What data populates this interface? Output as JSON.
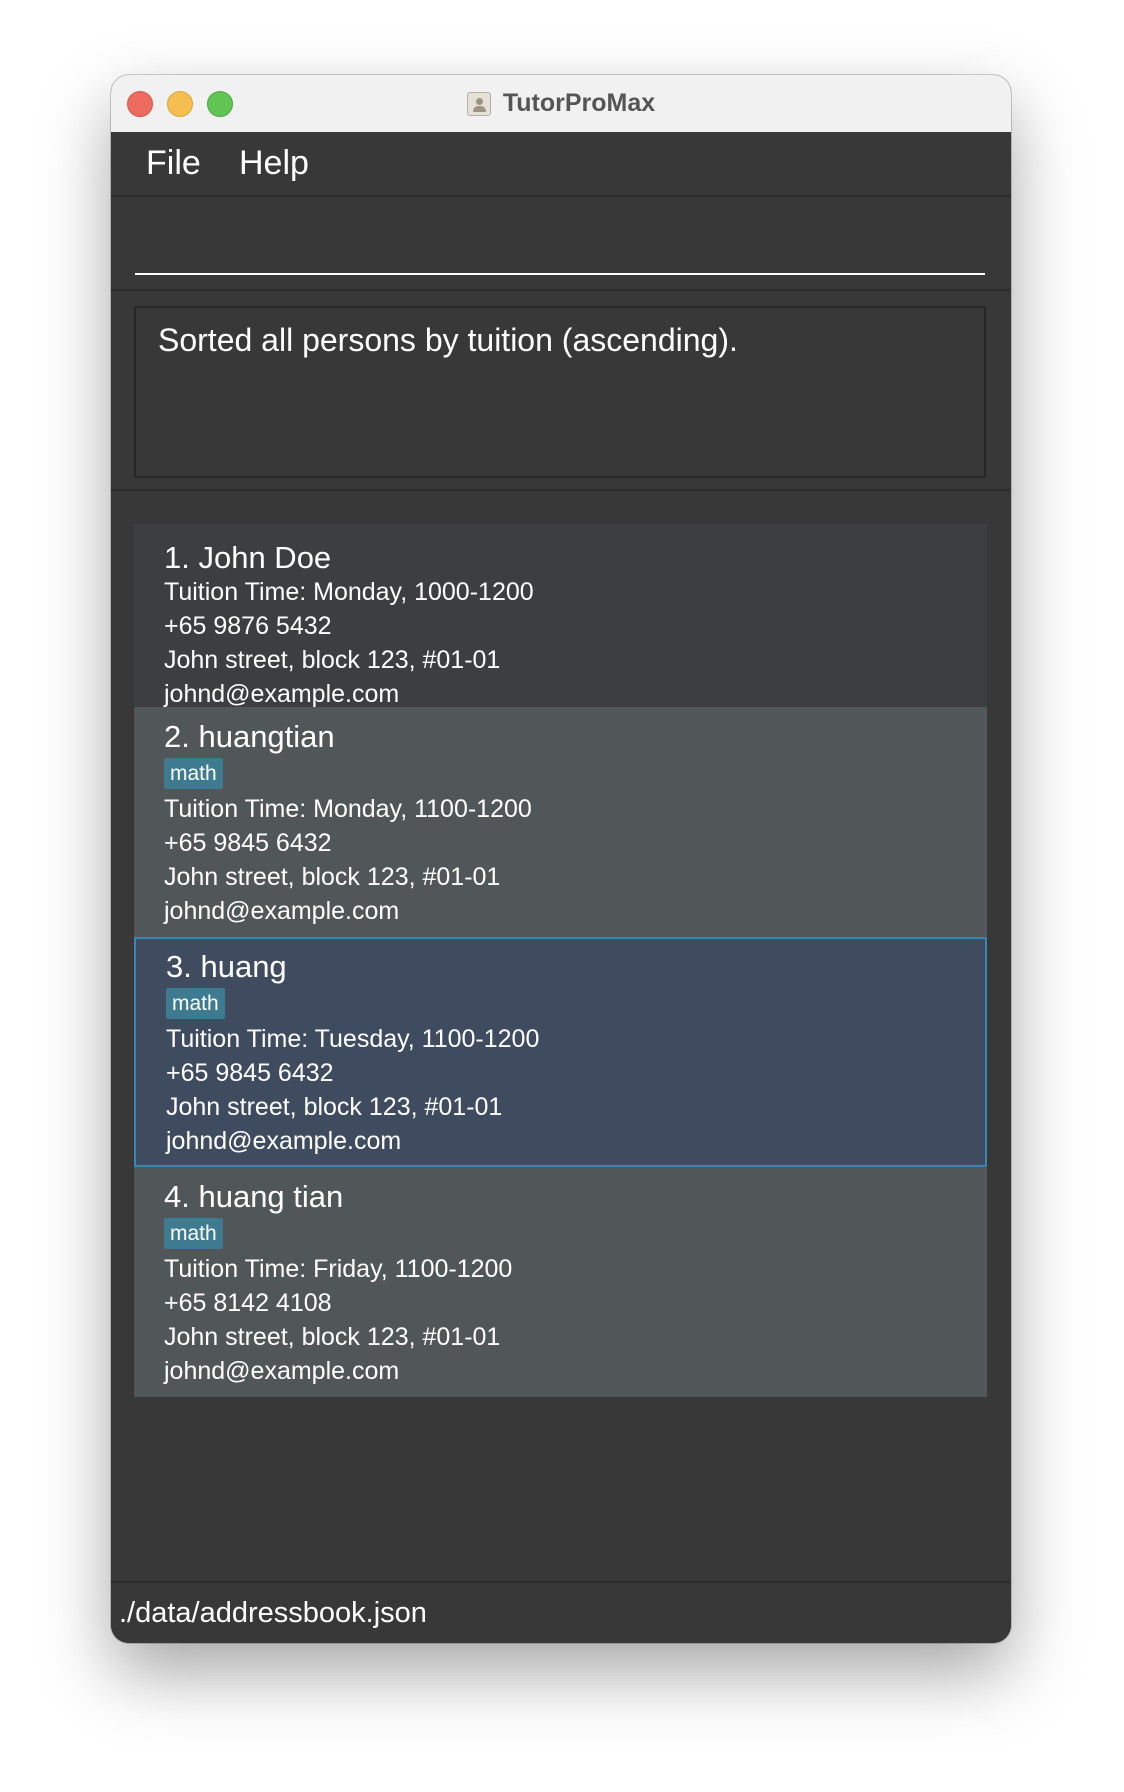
{
  "window": {
    "title": "TutorProMax"
  },
  "menu": {
    "file": "File",
    "help": "Help"
  },
  "command": {
    "value": ""
  },
  "result": {
    "message": "Sorted all persons by tuition (ascending)."
  },
  "persons": [
    {
      "title": "1. John Doe",
      "tags": [],
      "tuition": "Tuition Time: Monday, 1000-1200",
      "phone": "+65 9876 5432",
      "address": "John street, block 123, #01-01",
      "email": "johnd@example.com"
    },
    {
      "title": "2. huangtian",
      "tags": [
        "math"
      ],
      "tuition": "Tuition Time: Monday, 1100-1200",
      "phone": "+65 9845 6432",
      "address": "John street, block 123, #01-01",
      "email": "johnd@example.com"
    },
    {
      "title": "3. huang",
      "tags": [
        "math"
      ],
      "tuition": "Tuition Time: Tuesday, 1100-1200",
      "phone": "+65 9845 6432",
      "address": "John street, block 123, #01-01",
      "email": "johnd@example.com",
      "selected": true
    },
    {
      "title": "4. huang tian",
      "tags": [
        "math"
      ],
      "tuition": "Tuition Time: Friday, 1100-1200",
      "phone": "+65 8142 4108",
      "address": "John street, block 123, #01-01",
      "email": "johnd@example.com"
    }
  ],
  "status": {
    "path": "./data/addressbook.json"
  },
  "colors": {
    "window_bg": "#383838",
    "card_odd": "#3c3e3f",
    "card_even": "#515658",
    "card_selected": "#3f4c60",
    "selected_border": "#3a86b3",
    "tag_bg": "#3e7b91",
    "traffic_close": "#ed6a5e",
    "traffic_minimize": "#f5bf4f",
    "traffic_maximize": "#61c554"
  }
}
